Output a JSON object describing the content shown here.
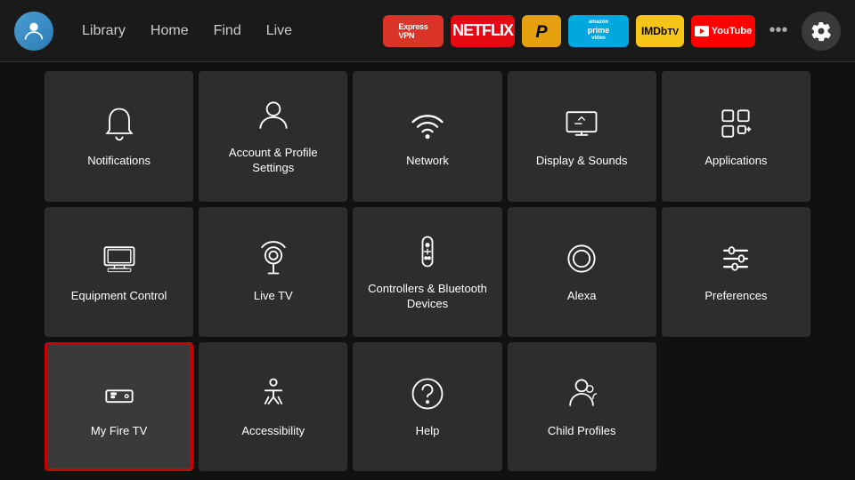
{
  "nav": {
    "links": [
      {
        "label": "Library",
        "id": "library"
      },
      {
        "label": "Home",
        "id": "home"
      },
      {
        "label": "Find",
        "id": "find"
      },
      {
        "label": "Live",
        "id": "live"
      }
    ],
    "apps": [
      {
        "label": "ExpressVPN",
        "id": "expressvpn"
      },
      {
        "label": "NETFLIX",
        "id": "netflix"
      },
      {
        "label": "Plex",
        "id": "plex"
      },
      {
        "label": "prime video",
        "id": "prime"
      },
      {
        "label": "IMDbTV",
        "id": "imdb"
      },
      {
        "label": "▶ YouTube",
        "id": "youtube"
      }
    ],
    "more_label": "•••",
    "settings_label": "Settings"
  },
  "tiles": [
    {
      "id": "notifications",
      "label": "Notifications",
      "icon": "bell",
      "focused": false
    },
    {
      "id": "account",
      "label": "Account & Profile Settings",
      "icon": "person",
      "focused": false
    },
    {
      "id": "network",
      "label": "Network",
      "icon": "wifi",
      "focused": false
    },
    {
      "id": "display",
      "label": "Display & Sounds",
      "icon": "display",
      "focused": false
    },
    {
      "id": "applications",
      "label": "Applications",
      "icon": "apps",
      "focused": false
    },
    {
      "id": "equipment",
      "label": "Equipment Control",
      "icon": "tv",
      "focused": false
    },
    {
      "id": "livetv",
      "label": "Live TV",
      "icon": "antenna",
      "focused": false
    },
    {
      "id": "controllers",
      "label": "Controllers & Bluetooth Devices",
      "icon": "remote",
      "focused": false
    },
    {
      "id": "alexa",
      "label": "Alexa",
      "icon": "alexa",
      "focused": false
    },
    {
      "id": "preferences",
      "label": "Preferences",
      "icon": "sliders",
      "focused": false
    },
    {
      "id": "myfiretv",
      "label": "My Fire TV",
      "icon": "firetv",
      "focused": true
    },
    {
      "id": "accessibility",
      "label": "Accessibility",
      "icon": "accessibility",
      "focused": false
    },
    {
      "id": "help",
      "label": "Help",
      "icon": "help",
      "focused": false
    },
    {
      "id": "childprofiles",
      "label": "Child Profiles",
      "icon": "childprofile",
      "focused": false
    }
  ]
}
